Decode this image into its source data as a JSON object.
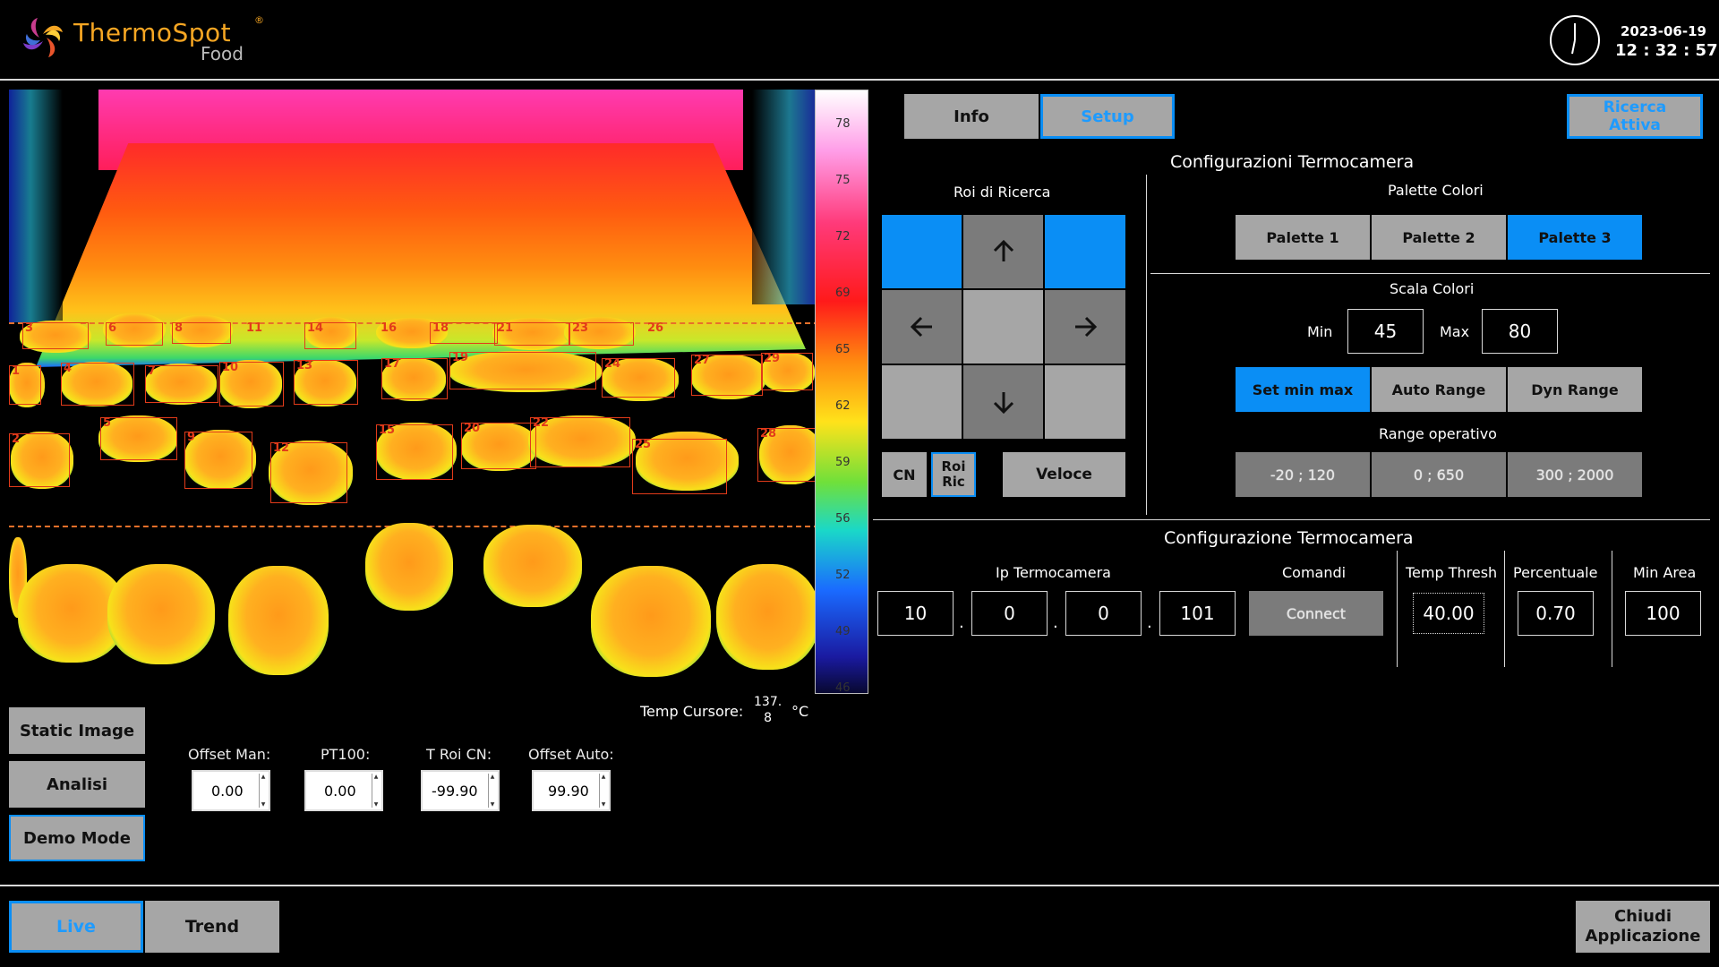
{
  "header": {
    "logo_name": "ThermoSpot",
    "logo_sub": "Food",
    "logo_mark": "®",
    "date": "2023-06-19",
    "time": "12 : 32 : 57"
  },
  "scale": {
    "ticks": [
      "78",
      "75",
      "72",
      "69",
      "65",
      "62",
      "59",
      "56",
      "52",
      "49",
      "46"
    ]
  },
  "roi_numbers": [
    "3",
    "6",
    "8",
    "11",
    "14",
    "16",
    "18",
    "21",
    "23",
    "26",
    "1",
    "4",
    "7",
    "10",
    "13",
    "17",
    "19",
    "24",
    "27",
    "29",
    "2",
    "5",
    "9",
    "12",
    "15",
    "20",
    "22",
    "25",
    "28"
  ],
  "cursor": {
    "label": "Temp Cursore:",
    "value": "137.\n8",
    "unit": "°C"
  },
  "left_buttons": {
    "static": "Static Image",
    "analisi": "Analisi",
    "demo": "Demo Mode"
  },
  "offsets": [
    {
      "label": "Offset Man:",
      "value": "0.00"
    },
    {
      "label": "PT100:",
      "value": "0.00"
    },
    {
      "label": "T Roi CN:",
      "value": "-99.90"
    },
    {
      "label": "Offset Auto:",
      "value": "99.90"
    }
  ],
  "tabs": {
    "info": "Info",
    "setup": "Setup"
  },
  "ricerca": {
    "line1": "Ricerca",
    "line2": "Attiva"
  },
  "config_title": "Configurazioni Termocamera",
  "roi_ricerca": {
    "title": "Roi di Ricerca",
    "cn": "CN",
    "roi_line1": "Roi",
    "roi_line2": "Ric",
    "veloce": "Veloce"
  },
  "palette": {
    "title": "Palette Colori",
    "p1": "Palette 1",
    "p2": "Palette 2",
    "p3": "Palette 3"
  },
  "scala": {
    "title": "Scala Colori",
    "min_label": "Min",
    "min_value": "45",
    "max_label": "Max",
    "max_value": "80",
    "set": "Set min max",
    "auto": "Auto Range",
    "dyn": "Dyn Range"
  },
  "range": {
    "title": "Range operativo",
    "r1": "-20 ; 120",
    "r2": "0 ; 650",
    "r3": "300 ; 2000"
  },
  "config2": {
    "title": "Configurazione Termocamera",
    "ip_label": "Ip Termocamera",
    "ip": [
      "10",
      "0",
      "0",
      "101"
    ],
    "dot": ".",
    "comandi_label": "Comandi",
    "connect": "Connect",
    "thresh_label": "Temp Thresh",
    "thresh": "40.00",
    "perc_label": "Percentuale",
    "perc": "0.70",
    "area_label": "Min Area",
    "area": "100"
  },
  "bottom": {
    "live": "Live",
    "trend": "Trend",
    "close1": "Chiudi",
    "close2": "Applicazione"
  },
  "colors": {
    "accent": "#0a8ef5",
    "button": "#a6a6a6",
    "background": "#000000"
  }
}
